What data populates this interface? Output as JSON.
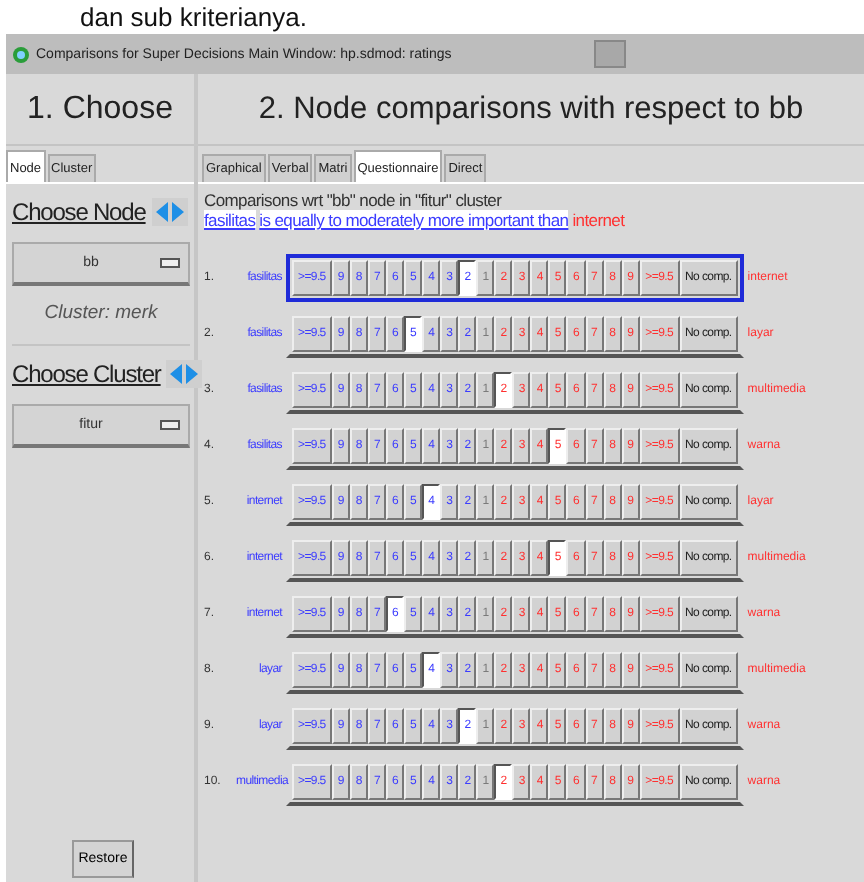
{
  "caption": "dan sub kriterianya.",
  "window": {
    "title": "Comparisons for Super Decisions Main Window: hp.sdmod: ratings"
  },
  "left": {
    "heading": "1. Choose",
    "tabs": [
      {
        "label": "Node",
        "selected": true
      },
      {
        "label": "Cluster",
        "selected": false
      }
    ],
    "choose_node": "Choose Node",
    "node": "bb",
    "cluster_info": "Cluster: merk",
    "choose_cluster": "Choose Cluster",
    "cluster": "fitur",
    "restore": "Restore"
  },
  "right": {
    "heading": "2. Node comparisons with respect to bb",
    "tabs": [
      {
        "label": "Graphical",
        "selected": false
      },
      {
        "label": "Verbal",
        "selected": false
      },
      {
        "label": "Matri",
        "selected": false
      },
      {
        "label": "Questionnaire",
        "selected": true
      },
      {
        "label": "Direct",
        "selected": false
      }
    ],
    "info": "Comparisons wrt \"bb\" node in \"fitur\" cluster",
    "verdict": {
      "left": "fasilitas",
      "phrase": "is equally to moderately more important than",
      "right": "internet"
    },
    "rows": [
      {
        "num": "1.",
        "left": "fasilitas",
        "right": "internet",
        "focused": true,
        "buttons": [
          {
            "label": ">=9.5",
            "kind": "left",
            "selected": false
          },
          {
            "label": "9",
            "kind": "left",
            "selected": false
          },
          {
            "label": "8",
            "kind": "left",
            "selected": false
          },
          {
            "label": "7",
            "kind": "left",
            "selected": false
          },
          {
            "label": "6",
            "kind": "left",
            "selected": false
          },
          {
            "label": "5",
            "kind": "left",
            "selected": false
          },
          {
            "label": "4",
            "kind": "left",
            "selected": false
          },
          {
            "label": "3",
            "kind": "left",
            "selected": false
          },
          {
            "label": "2",
            "kind": "left",
            "selected": true
          },
          {
            "label": "1",
            "kind": "equal",
            "selected": false
          },
          {
            "label": "2",
            "kind": "right",
            "selected": false
          },
          {
            "label": "3",
            "kind": "right",
            "selected": false
          },
          {
            "label": "4",
            "kind": "right",
            "selected": false
          },
          {
            "label": "5",
            "kind": "right",
            "selected": false
          },
          {
            "label": "6",
            "kind": "right",
            "selected": false
          },
          {
            "label": "7",
            "kind": "right",
            "selected": false
          },
          {
            "label": "8",
            "kind": "right",
            "selected": false
          },
          {
            "label": "9",
            "kind": "right",
            "selected": false
          },
          {
            "label": ">=9.5",
            "kind": "right",
            "selected": false
          },
          {
            "label": "No comp.",
            "kind": "none",
            "selected": false
          }
        ]
      },
      {
        "num": "2.",
        "left": "fasilitas",
        "right": "layar",
        "focused": false,
        "buttons": [
          {
            "label": ">=9.5",
            "kind": "left",
            "selected": false
          },
          {
            "label": "9",
            "kind": "left",
            "selected": false
          },
          {
            "label": "8",
            "kind": "left",
            "selected": false
          },
          {
            "label": "7",
            "kind": "left",
            "selected": false
          },
          {
            "label": "6",
            "kind": "left",
            "selected": false
          },
          {
            "label": "5",
            "kind": "left",
            "selected": true
          },
          {
            "label": "4",
            "kind": "left",
            "selected": false
          },
          {
            "label": "3",
            "kind": "left",
            "selected": false
          },
          {
            "label": "2",
            "kind": "left",
            "selected": false
          },
          {
            "label": "1",
            "kind": "equal",
            "selected": false
          },
          {
            "label": "2",
            "kind": "right",
            "selected": false
          },
          {
            "label": "3",
            "kind": "right",
            "selected": false
          },
          {
            "label": "4",
            "kind": "right",
            "selected": false
          },
          {
            "label": "5",
            "kind": "right",
            "selected": false
          },
          {
            "label": "6",
            "kind": "right",
            "selected": false
          },
          {
            "label": "7",
            "kind": "right",
            "selected": false
          },
          {
            "label": "8",
            "kind": "right",
            "selected": false
          },
          {
            "label": "9",
            "kind": "right",
            "selected": false
          },
          {
            "label": ">=9.5",
            "kind": "right",
            "selected": false
          },
          {
            "label": "No comp.",
            "kind": "none",
            "selected": false
          }
        ]
      },
      {
        "num": "3.",
        "left": "fasilitas",
        "right": "multimedia",
        "focused": false,
        "buttons": [
          {
            "label": ">=9.5",
            "kind": "left",
            "selected": false
          },
          {
            "label": "9",
            "kind": "left",
            "selected": false
          },
          {
            "label": "8",
            "kind": "left",
            "selected": false
          },
          {
            "label": "7",
            "kind": "left",
            "selected": false
          },
          {
            "label": "6",
            "kind": "left",
            "selected": false
          },
          {
            "label": "5",
            "kind": "left",
            "selected": false
          },
          {
            "label": "4",
            "kind": "left",
            "selected": false
          },
          {
            "label": "3",
            "kind": "left",
            "selected": false
          },
          {
            "label": "2",
            "kind": "left",
            "selected": false
          },
          {
            "label": "1",
            "kind": "equal",
            "selected": false
          },
          {
            "label": "2",
            "kind": "right",
            "selected": true
          },
          {
            "label": "3",
            "kind": "right",
            "selected": false
          },
          {
            "label": "4",
            "kind": "right",
            "selected": false
          },
          {
            "label": "5",
            "kind": "right",
            "selected": false
          },
          {
            "label": "6",
            "kind": "right",
            "selected": false
          },
          {
            "label": "7",
            "kind": "right",
            "selected": false
          },
          {
            "label": "8",
            "kind": "right",
            "selected": false
          },
          {
            "label": "9",
            "kind": "right",
            "selected": false
          },
          {
            "label": ">=9.5",
            "kind": "right",
            "selected": false
          },
          {
            "label": "No comp.",
            "kind": "none",
            "selected": false
          }
        ]
      },
      {
        "num": "4.",
        "left": "fasilitas",
        "right": "warna",
        "focused": false,
        "buttons": [
          {
            "label": ">=9.5",
            "kind": "left",
            "selected": false
          },
          {
            "label": "9",
            "kind": "left",
            "selected": false
          },
          {
            "label": "8",
            "kind": "left",
            "selected": false
          },
          {
            "label": "7",
            "kind": "left",
            "selected": false
          },
          {
            "label": "6",
            "kind": "left",
            "selected": false
          },
          {
            "label": "5",
            "kind": "left",
            "selected": false
          },
          {
            "label": "4",
            "kind": "left",
            "selected": false
          },
          {
            "label": "3",
            "kind": "left",
            "selected": false
          },
          {
            "label": "2",
            "kind": "left",
            "selected": false
          },
          {
            "label": "1",
            "kind": "equal",
            "selected": false
          },
          {
            "label": "2",
            "kind": "right",
            "selected": false
          },
          {
            "label": "3",
            "kind": "right",
            "selected": false
          },
          {
            "label": "4",
            "kind": "right",
            "selected": false
          },
          {
            "label": "5",
            "kind": "right",
            "selected": true
          },
          {
            "label": "6",
            "kind": "right",
            "selected": false
          },
          {
            "label": "7",
            "kind": "right",
            "selected": false
          },
          {
            "label": "8",
            "kind": "right",
            "selected": false
          },
          {
            "label": "9",
            "kind": "right",
            "selected": false
          },
          {
            "label": ">=9.5",
            "kind": "right",
            "selected": false
          },
          {
            "label": "No comp.",
            "kind": "none",
            "selected": false
          }
        ]
      },
      {
        "num": "5.",
        "left": "internet",
        "right": "layar",
        "focused": false,
        "buttons": [
          {
            "label": ">=9.5",
            "kind": "left",
            "selected": false
          },
          {
            "label": "9",
            "kind": "left",
            "selected": false
          },
          {
            "label": "8",
            "kind": "left",
            "selected": false
          },
          {
            "label": "7",
            "kind": "left",
            "selected": false
          },
          {
            "label": "6",
            "kind": "left",
            "selected": false
          },
          {
            "label": "5",
            "kind": "left",
            "selected": false
          },
          {
            "label": "4",
            "kind": "left",
            "selected": true
          },
          {
            "label": "3",
            "kind": "left",
            "selected": false
          },
          {
            "label": "2",
            "kind": "left",
            "selected": false
          },
          {
            "label": "1",
            "kind": "equal",
            "selected": false
          },
          {
            "label": "2",
            "kind": "right",
            "selected": false
          },
          {
            "label": "3",
            "kind": "right",
            "selected": false
          },
          {
            "label": "4",
            "kind": "right",
            "selected": false
          },
          {
            "label": "5",
            "kind": "right",
            "selected": false
          },
          {
            "label": "6",
            "kind": "right",
            "selected": false
          },
          {
            "label": "7",
            "kind": "right",
            "selected": false
          },
          {
            "label": "8",
            "kind": "right",
            "selected": false
          },
          {
            "label": "9",
            "kind": "right",
            "selected": false
          },
          {
            "label": ">=9.5",
            "kind": "right",
            "selected": false
          },
          {
            "label": "No comp.",
            "kind": "none",
            "selected": false
          }
        ]
      },
      {
        "num": "6.",
        "left": "internet",
        "right": "multimedia",
        "focused": false,
        "buttons": [
          {
            "label": ">=9.5",
            "kind": "left",
            "selected": false
          },
          {
            "label": "9",
            "kind": "left",
            "selected": false
          },
          {
            "label": "8",
            "kind": "left",
            "selected": false
          },
          {
            "label": "7",
            "kind": "left",
            "selected": false
          },
          {
            "label": "6",
            "kind": "left",
            "selected": false
          },
          {
            "label": "5",
            "kind": "left",
            "selected": false
          },
          {
            "label": "4",
            "kind": "left",
            "selected": false
          },
          {
            "label": "3",
            "kind": "left",
            "selected": false
          },
          {
            "label": "2",
            "kind": "left",
            "selected": false
          },
          {
            "label": "1",
            "kind": "equal",
            "selected": false
          },
          {
            "label": "2",
            "kind": "right",
            "selected": false
          },
          {
            "label": "3",
            "kind": "right",
            "selected": false
          },
          {
            "label": "4",
            "kind": "right",
            "selected": false
          },
          {
            "label": "5",
            "kind": "right",
            "selected": true
          },
          {
            "label": "6",
            "kind": "right",
            "selected": false
          },
          {
            "label": "7",
            "kind": "right",
            "selected": false
          },
          {
            "label": "8",
            "kind": "right",
            "selected": false
          },
          {
            "label": "9",
            "kind": "right",
            "selected": false
          },
          {
            "label": ">=9.5",
            "kind": "right",
            "selected": false
          },
          {
            "label": "No comp.",
            "kind": "none",
            "selected": false
          }
        ]
      },
      {
        "num": "7.",
        "left": "internet",
        "right": "warna",
        "focused": false,
        "buttons": [
          {
            "label": ">=9.5",
            "kind": "left",
            "selected": false
          },
          {
            "label": "9",
            "kind": "left",
            "selected": false
          },
          {
            "label": "8",
            "kind": "left",
            "selected": false
          },
          {
            "label": "7",
            "kind": "left",
            "selected": false
          },
          {
            "label": "6",
            "kind": "left",
            "selected": true
          },
          {
            "label": "5",
            "kind": "left",
            "selected": false
          },
          {
            "label": "4",
            "kind": "left",
            "selected": false
          },
          {
            "label": "3",
            "kind": "left",
            "selected": false
          },
          {
            "label": "2",
            "kind": "left",
            "selected": false
          },
          {
            "label": "1",
            "kind": "equal",
            "selected": false
          },
          {
            "label": "2",
            "kind": "right",
            "selected": false
          },
          {
            "label": "3",
            "kind": "right",
            "selected": false
          },
          {
            "label": "4",
            "kind": "right",
            "selected": false
          },
          {
            "label": "5",
            "kind": "right",
            "selected": false
          },
          {
            "label": "6",
            "kind": "right",
            "selected": false
          },
          {
            "label": "7",
            "kind": "right",
            "selected": false
          },
          {
            "label": "8",
            "kind": "right",
            "selected": false
          },
          {
            "label": "9",
            "kind": "right",
            "selected": false
          },
          {
            "label": ">=9.5",
            "kind": "right",
            "selected": false
          },
          {
            "label": "No comp.",
            "kind": "none",
            "selected": false
          }
        ]
      },
      {
        "num": "8.",
        "left": "layar",
        "right": "multimedia",
        "focused": false,
        "buttons": [
          {
            "label": ">=9.5",
            "kind": "left",
            "selected": false
          },
          {
            "label": "9",
            "kind": "left",
            "selected": false
          },
          {
            "label": "8",
            "kind": "left",
            "selected": false
          },
          {
            "label": "7",
            "kind": "left",
            "selected": false
          },
          {
            "label": "6",
            "kind": "left",
            "selected": false
          },
          {
            "label": "5",
            "kind": "left",
            "selected": false
          },
          {
            "label": "4",
            "kind": "left",
            "selected": true
          },
          {
            "label": "3",
            "kind": "left",
            "selected": false
          },
          {
            "label": "2",
            "kind": "left",
            "selected": false
          },
          {
            "label": "1",
            "kind": "equal",
            "selected": false
          },
          {
            "label": "2",
            "kind": "right",
            "selected": false
          },
          {
            "label": "3",
            "kind": "right",
            "selected": false
          },
          {
            "label": "4",
            "kind": "right",
            "selected": false
          },
          {
            "label": "5",
            "kind": "right",
            "selected": false
          },
          {
            "label": "6",
            "kind": "right",
            "selected": false
          },
          {
            "label": "7",
            "kind": "right",
            "selected": false
          },
          {
            "label": "8",
            "kind": "right",
            "selected": false
          },
          {
            "label": "9",
            "kind": "right",
            "selected": false
          },
          {
            "label": ">=9.5",
            "kind": "right",
            "selected": false
          },
          {
            "label": "No comp.",
            "kind": "none",
            "selected": false
          }
        ]
      },
      {
        "num": "9.",
        "left": "layar",
        "right": "warna",
        "focused": false,
        "buttons": [
          {
            "label": ">=9.5",
            "kind": "left",
            "selected": false
          },
          {
            "label": "9",
            "kind": "left",
            "selected": false
          },
          {
            "label": "8",
            "kind": "left",
            "selected": false
          },
          {
            "label": "7",
            "kind": "left",
            "selected": false
          },
          {
            "label": "6",
            "kind": "left",
            "selected": false
          },
          {
            "label": "5",
            "kind": "left",
            "selected": false
          },
          {
            "label": "4",
            "kind": "left",
            "selected": false
          },
          {
            "label": "3",
            "kind": "left",
            "selected": false
          },
          {
            "label": "2",
            "kind": "left",
            "selected": true
          },
          {
            "label": "1",
            "kind": "equal",
            "selected": false
          },
          {
            "label": "2",
            "kind": "right",
            "selected": false
          },
          {
            "label": "3",
            "kind": "right",
            "selected": false
          },
          {
            "label": "4",
            "kind": "right",
            "selected": false
          },
          {
            "label": "5",
            "kind": "right",
            "selected": false
          },
          {
            "label": "6",
            "kind": "right",
            "selected": false
          },
          {
            "label": "7",
            "kind": "right",
            "selected": false
          },
          {
            "label": "8",
            "kind": "right",
            "selected": false
          },
          {
            "label": "9",
            "kind": "right",
            "selected": false
          },
          {
            "label": ">=9.5",
            "kind": "right",
            "selected": false
          },
          {
            "label": "No comp.",
            "kind": "none",
            "selected": false
          }
        ]
      },
      {
        "num": "10.",
        "left": "multimedia",
        "right": "warna",
        "focused": false,
        "buttons": [
          {
            "label": ">=9.5",
            "kind": "left",
            "selected": false
          },
          {
            "label": "9",
            "kind": "left",
            "selected": false
          },
          {
            "label": "8",
            "kind": "left",
            "selected": false
          },
          {
            "label": "7",
            "kind": "left",
            "selected": false
          },
          {
            "label": "6",
            "kind": "left",
            "selected": false
          },
          {
            "label": "5",
            "kind": "left",
            "selected": false
          },
          {
            "label": "4",
            "kind": "left",
            "selected": false
          },
          {
            "label": "3",
            "kind": "left",
            "selected": false
          },
          {
            "label": "2",
            "kind": "left",
            "selected": false
          },
          {
            "label": "1",
            "kind": "equal",
            "selected": false
          },
          {
            "label": "2",
            "kind": "right",
            "selected": true
          },
          {
            "label": "3",
            "kind": "right",
            "selected": false
          },
          {
            "label": "4",
            "kind": "right",
            "selected": false
          },
          {
            "label": "5",
            "kind": "right",
            "selected": false
          },
          {
            "label": "6",
            "kind": "right",
            "selected": false
          },
          {
            "label": "7",
            "kind": "right",
            "selected": false
          },
          {
            "label": "8",
            "kind": "right",
            "selected": false
          },
          {
            "label": "9",
            "kind": "right",
            "selected": false
          },
          {
            "label": ">=9.5",
            "kind": "right",
            "selected": false
          },
          {
            "label": "No comp.",
            "kind": "none",
            "selected": false
          }
        ]
      }
    ]
  }
}
